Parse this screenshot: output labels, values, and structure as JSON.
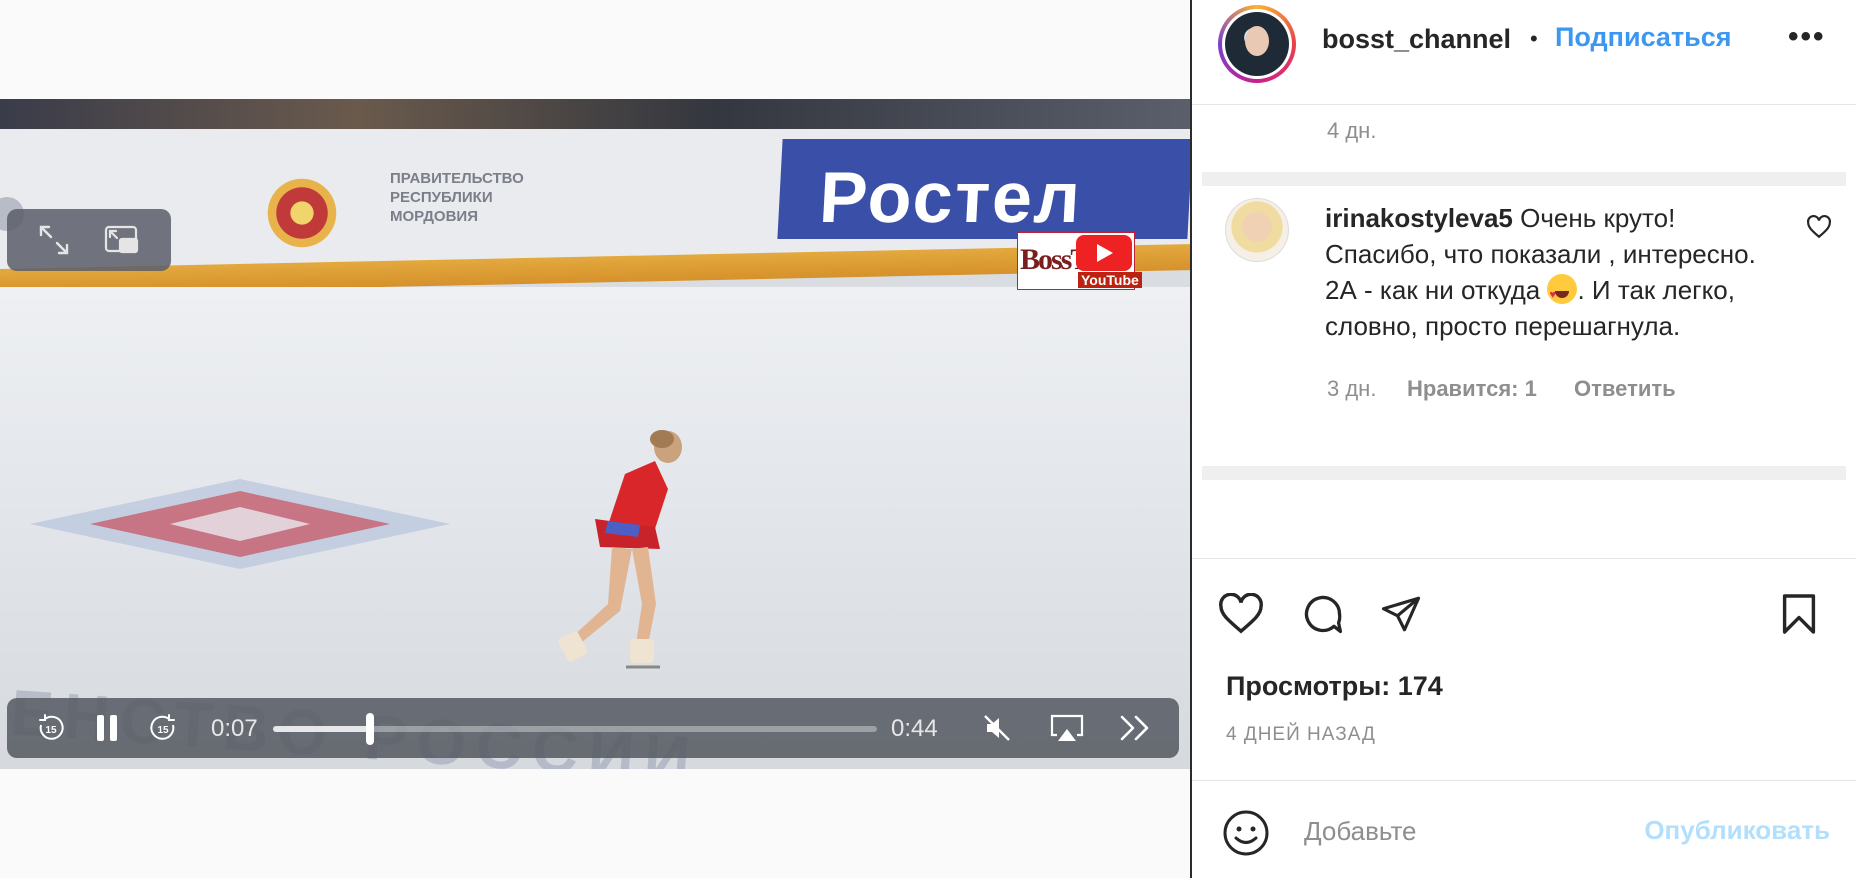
{
  "video": {
    "watermark_brand": "BossT",
    "watermark_platform": "YouTube",
    "board_ad_text": "Ростел",
    "board_gov_text": "ПРАВИТЕЛЬСТВО\nРЕСПУБЛИКИ\nМОРДОВИЯ",
    "ice_text": "ЕНСТВО РОССИИ",
    "current_time": "0:07",
    "duration": "0:44",
    "progress_fraction": 0.16,
    "icons": {
      "fullscreen": "expand-icon",
      "pip": "picture-in-picture-icon",
      "skip_back": "skip-back-15-icon",
      "pause": "pause-icon",
      "skip_forward": "skip-forward-15-icon",
      "mute": "speaker-muted-icon",
      "airplay": "airplay-icon",
      "speed": "fast-forward-icon"
    }
  },
  "header": {
    "username": "bosst_channel",
    "separator": "•",
    "follow_label": "Подписаться",
    "more_icon": "more-horizontal-icon"
  },
  "comments": {
    "previous_meta_time": "4 дн.",
    "items": [
      {
        "user": "irinakostyleva5",
        "text_before_emoji": " Очень круто! Спасибо, что показали , интересно. 2А - как ни откуда ",
        "emoji": "heart-eyes-emoji",
        "text_after_emoji": ". И так легко, словно, просто перешагнула.",
        "time": "3 дн.",
        "likes": "Нравится: 1",
        "reply_label": "Ответить"
      }
    ]
  },
  "actions": {
    "views": "Просмотры: 174",
    "posted_ago": "4 ДНЕЙ НАЗАД"
  },
  "composer": {
    "placeholder": "Добавьте",
    "publish_label": "Опубликовать"
  },
  "colors": {
    "accent_blue": "#3b97f0",
    "publish_disabled": "#b2dffc",
    "text_primary": "#262626",
    "text_secondary": "#8e8e8e"
  }
}
